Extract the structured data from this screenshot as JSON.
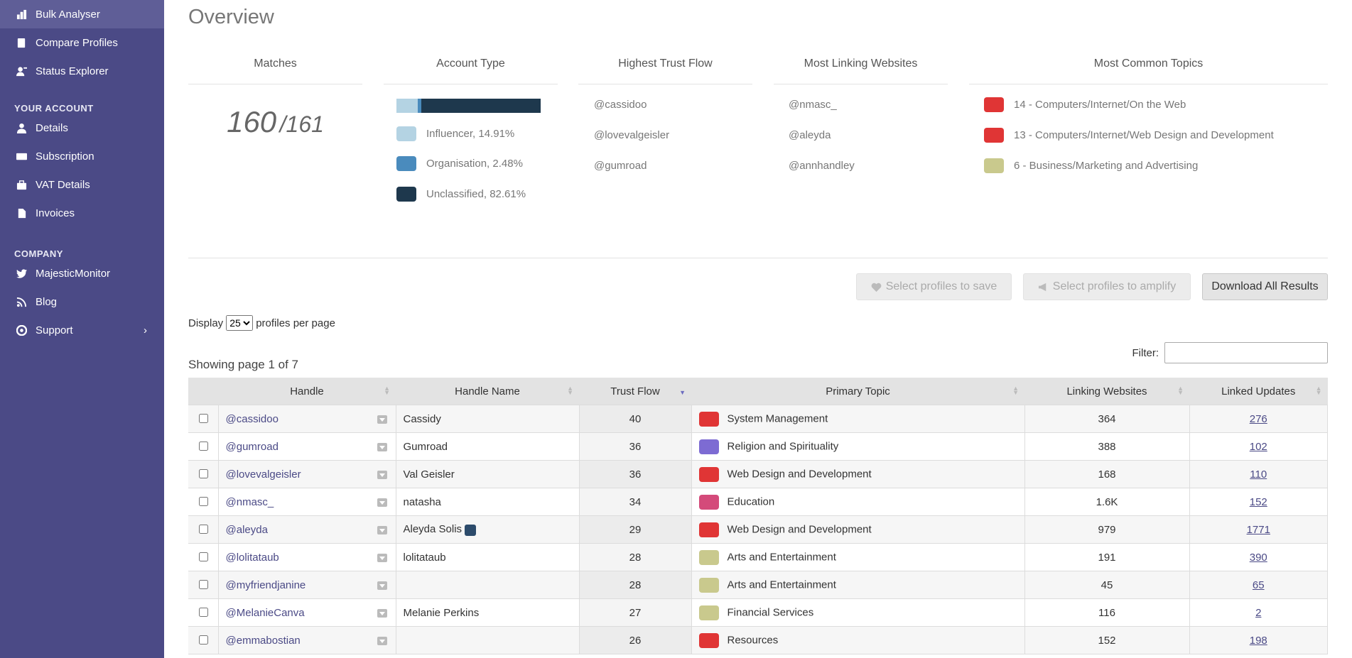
{
  "sidebar": {
    "items": [
      {
        "label": "Bulk Analyser",
        "icon": "bulk-icon",
        "active": true
      },
      {
        "label": "Compare Profiles",
        "icon": "compare-icon"
      },
      {
        "label": "Status Explorer",
        "icon": "status-icon"
      }
    ],
    "account_heading": "YOUR ACCOUNT",
    "account_items": [
      {
        "label": "Details",
        "icon": "user-icon"
      },
      {
        "label": "Subscription",
        "icon": "card-icon"
      },
      {
        "label": "VAT Details",
        "icon": "briefcase-icon"
      },
      {
        "label": "Invoices",
        "icon": "document-icon"
      }
    ],
    "company_heading": "COMPANY",
    "company_items": [
      {
        "label": "MajesticMonitor",
        "icon": "twitter-icon"
      },
      {
        "label": "Blog",
        "icon": "rss-icon"
      },
      {
        "label": "Support",
        "icon": "lifebuoy-icon"
      }
    ]
  },
  "overview": {
    "title": "Overview",
    "matches": {
      "heading": "Matches",
      "count": "160",
      "total": "/161"
    },
    "account_type": {
      "heading": "Account Type",
      "legend": [
        {
          "label": "Influencer, 14.91%",
          "color": "#b4d3e3",
          "percent": 14.91
        },
        {
          "label": "Organisation, 2.48%",
          "color": "#4a8bbd",
          "percent": 2.48
        },
        {
          "label": "Unclassified, 82.61%",
          "color": "#1e384d",
          "percent": 82.61
        }
      ]
    },
    "trust_flow": {
      "heading": "Highest Trust Flow",
      "items": [
        "@cassidoo",
        "@lovevalgeisler",
        "@gumroad"
      ]
    },
    "linking": {
      "heading": "Most Linking Websites",
      "items": [
        "@nmasc_",
        "@aleyda",
        "@annhandley"
      ]
    },
    "topics": {
      "heading": "Most Common Topics",
      "items": [
        {
          "label": "14 - Computers/Internet/On the Web",
          "color": "#e03535"
        },
        {
          "label": "13 - Computers/Internet/Web Design and Development",
          "color": "#e03535"
        },
        {
          "label": "6 - Business/Marketing and Advertising",
          "color": "#c9c98d"
        }
      ]
    }
  },
  "actions": {
    "save": "Select profiles to save",
    "amplify": "Select profiles to amplify",
    "download": "Download All Results"
  },
  "display": {
    "prefix": "Display",
    "value": "25",
    "suffix": "profiles per page"
  },
  "showing": "Showing page 1 of 7",
  "filter_label": "Filter:",
  "table": {
    "headers": [
      "Handle",
      "Handle Name",
      "Trust Flow",
      "Primary Topic",
      "Linking Websites",
      "Linked Updates"
    ],
    "rows": [
      {
        "handle": "@cassidoo",
        "name": "Cassidy",
        "tf": "40",
        "topic": "System Management",
        "color": "#e03535",
        "linking": "364",
        "updates": "276"
      },
      {
        "handle": "@gumroad",
        "name": "Gumroad",
        "tf": "36",
        "topic": "Religion and Spirituality",
        "color": "#7d6bd3",
        "linking": "388",
        "updates": "102"
      },
      {
        "handle": "@lovevalgeisler",
        "name": "Val Geisler",
        "tf": "36",
        "topic": "Web Design and Development",
        "color": "#e03535",
        "linking": "168",
        "updates": "110"
      },
      {
        "handle": "@nmasc_",
        "name": "natasha",
        "tf": "34",
        "topic": "Education",
        "color": "#d44a7a",
        "linking": "1.6K",
        "updates": "152"
      },
      {
        "handle": "@aleyda",
        "name": "Aleyda Solis",
        "tf": "29",
        "topic": "Web Design and Development",
        "color": "#e03535",
        "linking": "979",
        "updates": "1771",
        "emoji": true
      },
      {
        "handle": "@lolitataub",
        "name": "lolitataub",
        "tf": "28",
        "topic": "Arts and Entertainment",
        "color": "#c9c98d",
        "linking": "191",
        "updates": "390"
      },
      {
        "handle": "@myfriendjanine",
        "name": "",
        "tf": "28",
        "topic": "Arts and Entertainment",
        "color": "#c9c98d",
        "linking": "45",
        "updates": "65"
      },
      {
        "handle": "@MelanieCanva",
        "name": "Melanie Perkins",
        "tf": "27",
        "topic": "Financial Services",
        "color": "#c9c98d",
        "linking": "116",
        "updates": "2"
      },
      {
        "handle": "@emmabostian",
        "name": "",
        "tf": "26",
        "topic": "Resources",
        "color": "#e03535",
        "linking": "152",
        "updates": "198"
      }
    ]
  }
}
